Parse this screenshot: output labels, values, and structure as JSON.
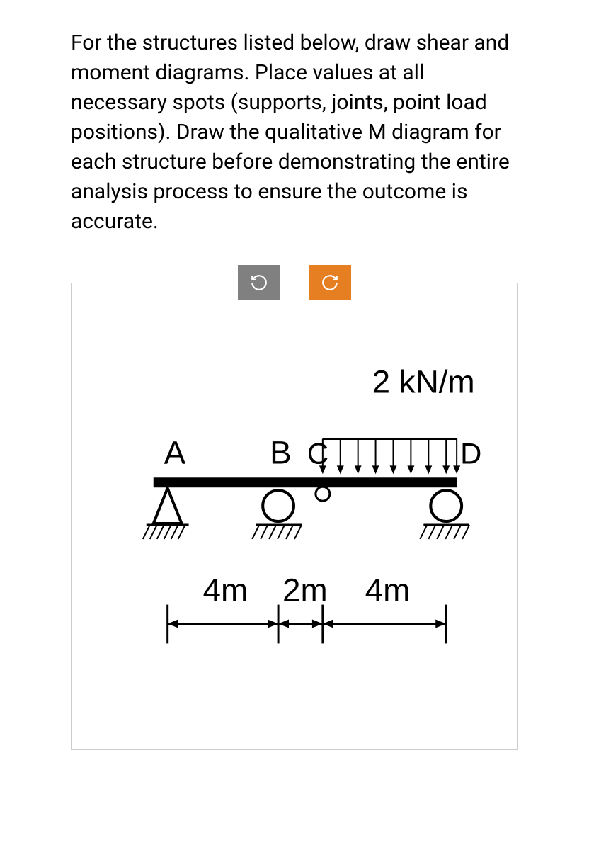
{
  "problem": {
    "text": "For the structures listed below, draw shear and moment diagrams. Place values at all necessary spots (supports, joints, point load positions). Draw the qualitative M diagram for each structure before demonstrating the entire analysis process to ensure the outcome is accurate."
  },
  "diagram": {
    "load_label": "2 kN/m",
    "points": {
      "A": "A",
      "B": "B",
      "C": "C",
      "D": "D"
    },
    "dimensions": {
      "span1": "4m",
      "span2": "2m",
      "span3": "4m"
    }
  }
}
